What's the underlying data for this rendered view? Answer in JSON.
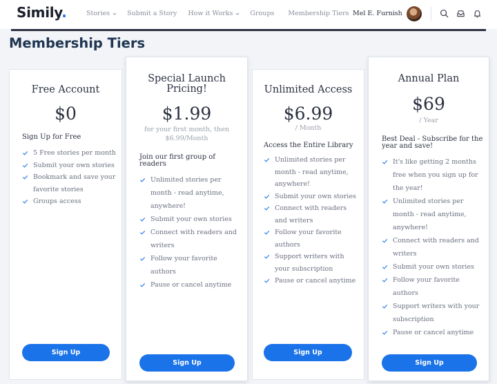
{
  "header": {
    "logo_text": "Simily",
    "logo_dot": ".",
    "nav": {
      "stories": "Stories",
      "submit": "Submit a Story",
      "how": "How it Works",
      "groups": "Groups",
      "membership": "Membership Tiers"
    },
    "user_name": "Mel E. Furnish",
    "icons": [
      "search-icon",
      "inbox-icon",
      "bell-icon",
      "chevron-down-icon"
    ]
  },
  "page": {
    "title": "Membership Tiers"
  },
  "tiers": [
    {
      "title": "Free Account",
      "price": "$0",
      "price_note": "",
      "lead": "Sign Up for Free",
      "features": [
        "5 Free stories per month",
        "Submit your own stories",
        "Bookmark and save your favorite stories",
        "Groups access"
      ],
      "button": "Sign Up"
    },
    {
      "title": "Special Launch Pricing!",
      "price": "$1.99",
      "price_note": "for your first month, then $6.99/Month",
      "lead": "Join our first group of readers",
      "features": [
        "Unlimited stories per month - read anytime, anywhere!",
        "Submit your own stories",
        "Connect with readers and writers",
        "Follow your favorite authors",
        "Pause or cancel anytime"
      ],
      "button": "Sign Up"
    },
    {
      "title": "Unlimited Access",
      "price": "$6.99",
      "price_note": "/ Month",
      "lead": "Access the Entire Library",
      "features": [
        "Unlimited stories per month - read anytime, anywhere!",
        "Submit your own stories",
        "Connect with readers and writers",
        "Follow your favorite authors",
        "Support writers with your subscription",
        "Pause or cancel anytime"
      ],
      "button": "Sign Up"
    },
    {
      "title": "Annual Plan",
      "price": "$69",
      "price_note": "/ Year",
      "lead": "Best Deal - Subscribe for the year and save!",
      "features": [
        "It's like getting 2 months free when you sign up for the year!",
        "Unlimited stories per month - read anytime, anywhere!",
        "Connect with readers and writers",
        "Submit your own stories",
        "Follow your favorite authors",
        "Support writers with your subscription",
        "Pause or cancel anytime"
      ],
      "button": "Sign Up"
    }
  ],
  "colors": {
    "accent": "#1a73e8",
    "heading": "#1f3550",
    "check": "#1a73e8"
  }
}
